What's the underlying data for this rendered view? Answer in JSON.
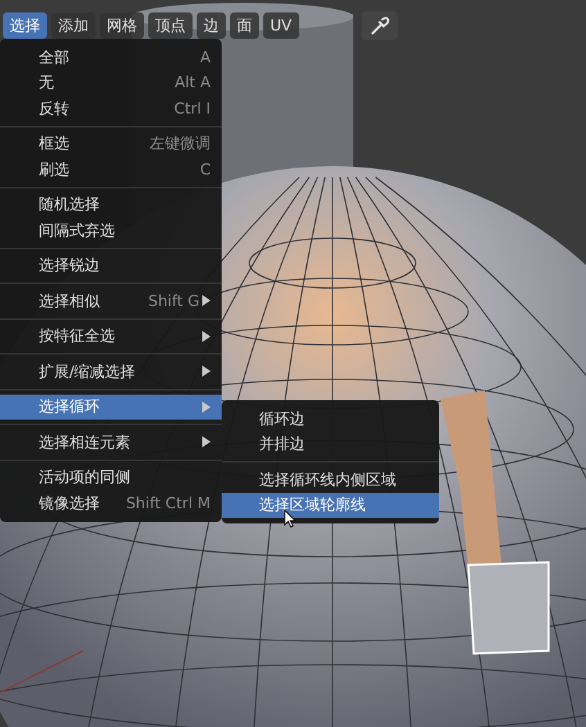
{
  "header_menus": [
    {
      "label": "选择",
      "selected": true
    },
    {
      "label": "添加",
      "selected": false
    },
    {
      "label": "网格",
      "selected": false
    },
    {
      "label": "顶点",
      "selected": false
    },
    {
      "label": "边",
      "selected": false
    },
    {
      "label": "面",
      "selected": false
    },
    {
      "label": "UV",
      "selected": false
    }
  ],
  "select_menu": {
    "sections": [
      [
        {
          "label": "全部",
          "shortcut": "A",
          "submenu": false,
          "selected": false
        },
        {
          "label": "无",
          "shortcut": "Alt A",
          "submenu": false,
          "selected": false
        },
        {
          "label": "反转",
          "shortcut": "Ctrl I",
          "submenu": false,
          "selected": false
        }
      ],
      [
        {
          "label": "框选",
          "shortcut": "左键微调",
          "submenu": false,
          "selected": false
        },
        {
          "label": "刷选",
          "shortcut": "C",
          "submenu": false,
          "selected": false
        }
      ],
      [
        {
          "label": "随机选择",
          "submenu": false,
          "selected": false
        },
        {
          "label": "间隔式弃选",
          "submenu": false,
          "selected": false
        }
      ],
      [
        {
          "label": "选择锐边",
          "submenu": false,
          "selected": false
        }
      ],
      [
        {
          "label": "选择相似",
          "shortcut": "Shift G",
          "submenu": true,
          "selected": false
        }
      ],
      [
        {
          "label": "按特征全选",
          "submenu": true,
          "selected": false
        }
      ],
      [
        {
          "label": "扩展/缩减选择",
          "submenu": true,
          "selected": false
        }
      ],
      [
        {
          "label": "选择循环",
          "submenu": true,
          "selected": true
        }
      ],
      [
        {
          "label": "选择相连元素",
          "submenu": true,
          "selected": false
        }
      ],
      [
        {
          "label": "活动项的同侧",
          "submenu": false,
          "selected": false
        },
        {
          "label": "镜像选择",
          "shortcut": "Shift Ctrl M",
          "submenu": false,
          "selected": false
        }
      ]
    ]
  },
  "loop_submenu": {
    "sections": [
      [
        {
          "label": "循环边",
          "selected": false
        },
        {
          "label": "并排边",
          "selected": false
        }
      ],
      [
        {
          "label": "选择循环线内侧区域",
          "selected": false
        },
        {
          "label": "选择区域轮廓线",
          "selected": true
        }
      ]
    ]
  }
}
